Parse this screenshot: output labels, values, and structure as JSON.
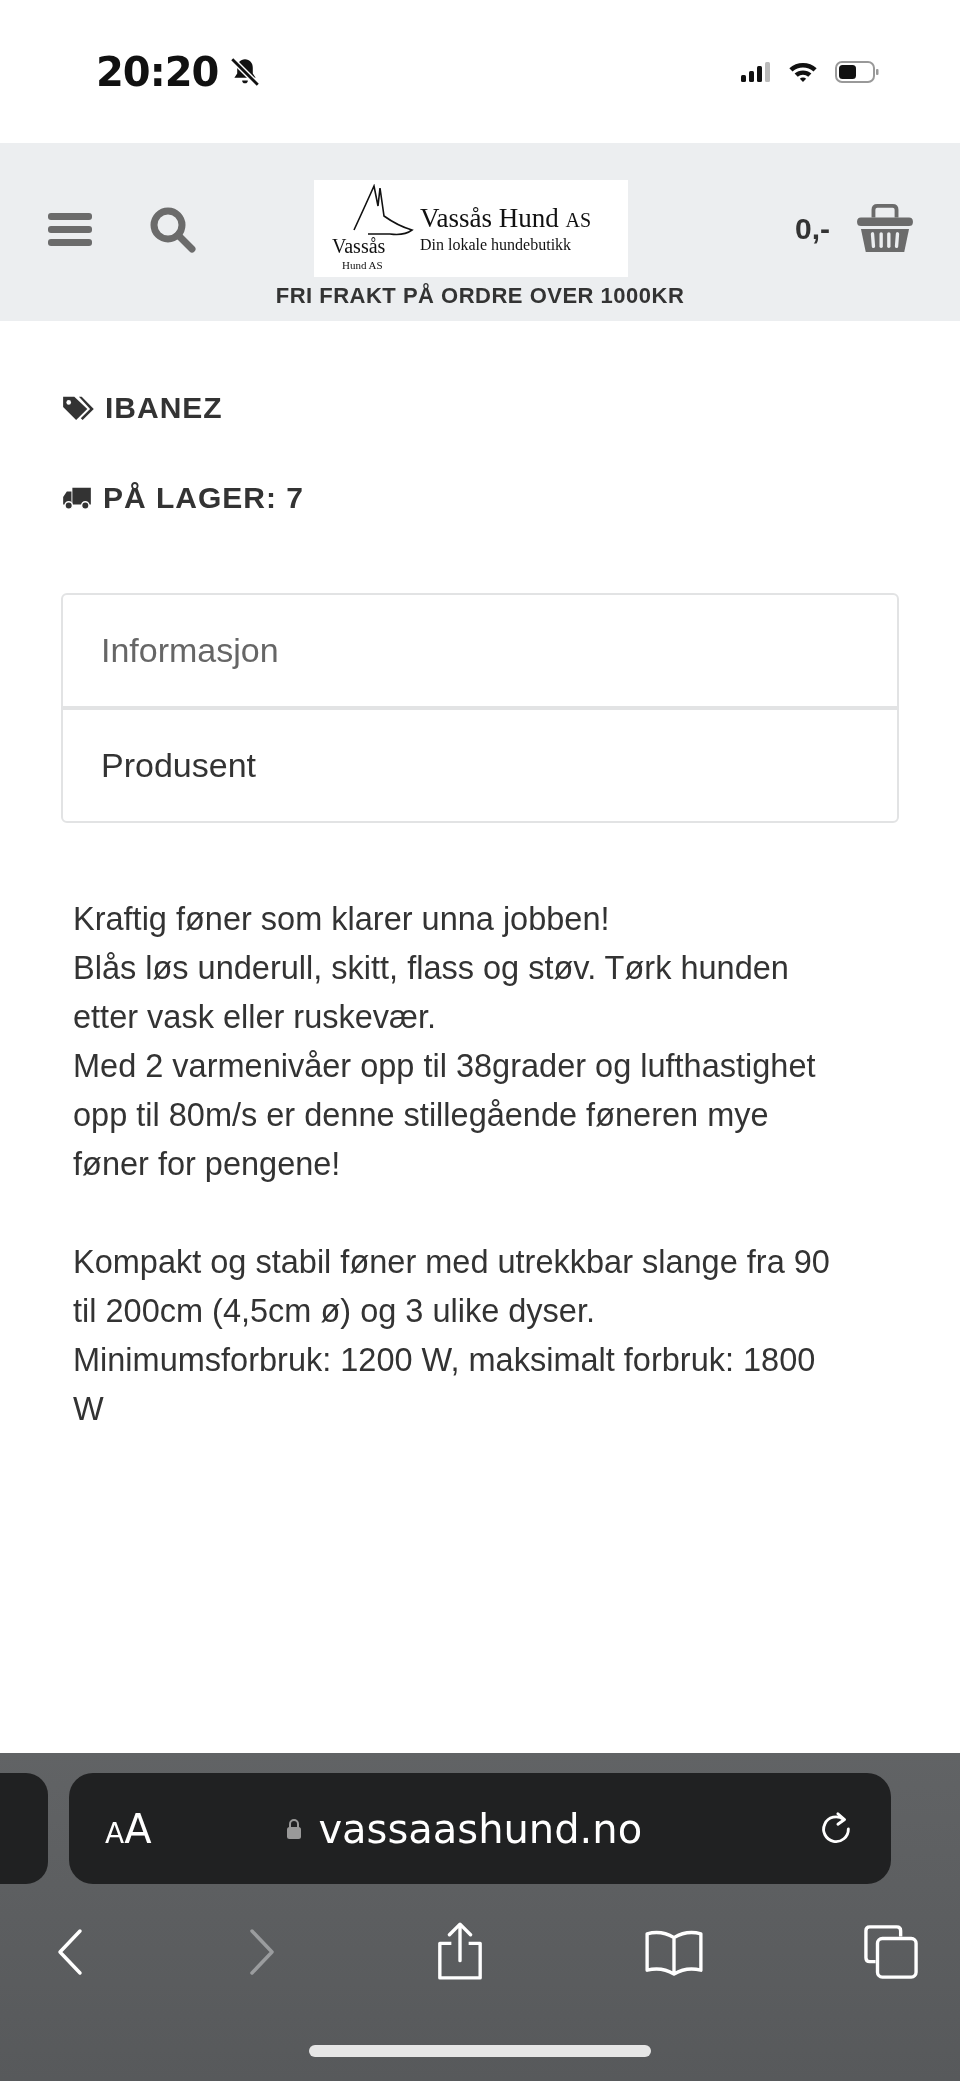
{
  "status_bar": {
    "time": "20:20",
    "silent": true
  },
  "header": {
    "logo": {
      "monogram": "Vassås",
      "monogram_sub": "Hund AS",
      "name": "Vassås Hund",
      "name_suffix": "AS",
      "tagline": "Din lokale hundebutikk"
    },
    "cart_total": "0,-",
    "banner": "FRI FRAKT PÅ ORDRE OVER 1000KR"
  },
  "product": {
    "brand": "IBANEZ",
    "stock": "PÅ LAGER: 7"
  },
  "tabs": [
    {
      "label": "Informasjon",
      "selected": true
    },
    {
      "label": "Produsent",
      "selected": false
    }
  ],
  "description": [
    [
      "Kraftig føner som klarer unna jobben!",
      "Blås løs underull, skitt, flass og støv. Tørk hunden etter vask eller ruskevær.",
      "Med 2 varmenivåer opp til 38grader og lufthastighet opp til 80m/s er denne stillegående føneren mye føner for pengene!"
    ],
    [
      "Kompakt og stabil føner med utrekkbar slange fra 90 til 200cm (4,5cm ø) og 3 ulike dyser.",
      "Minimumsforbruk: 1200 W, maksimalt forbruk: 1800 W"
    ]
  ],
  "browser": {
    "text_size": "AA",
    "url": "vassaashund.no"
  }
}
